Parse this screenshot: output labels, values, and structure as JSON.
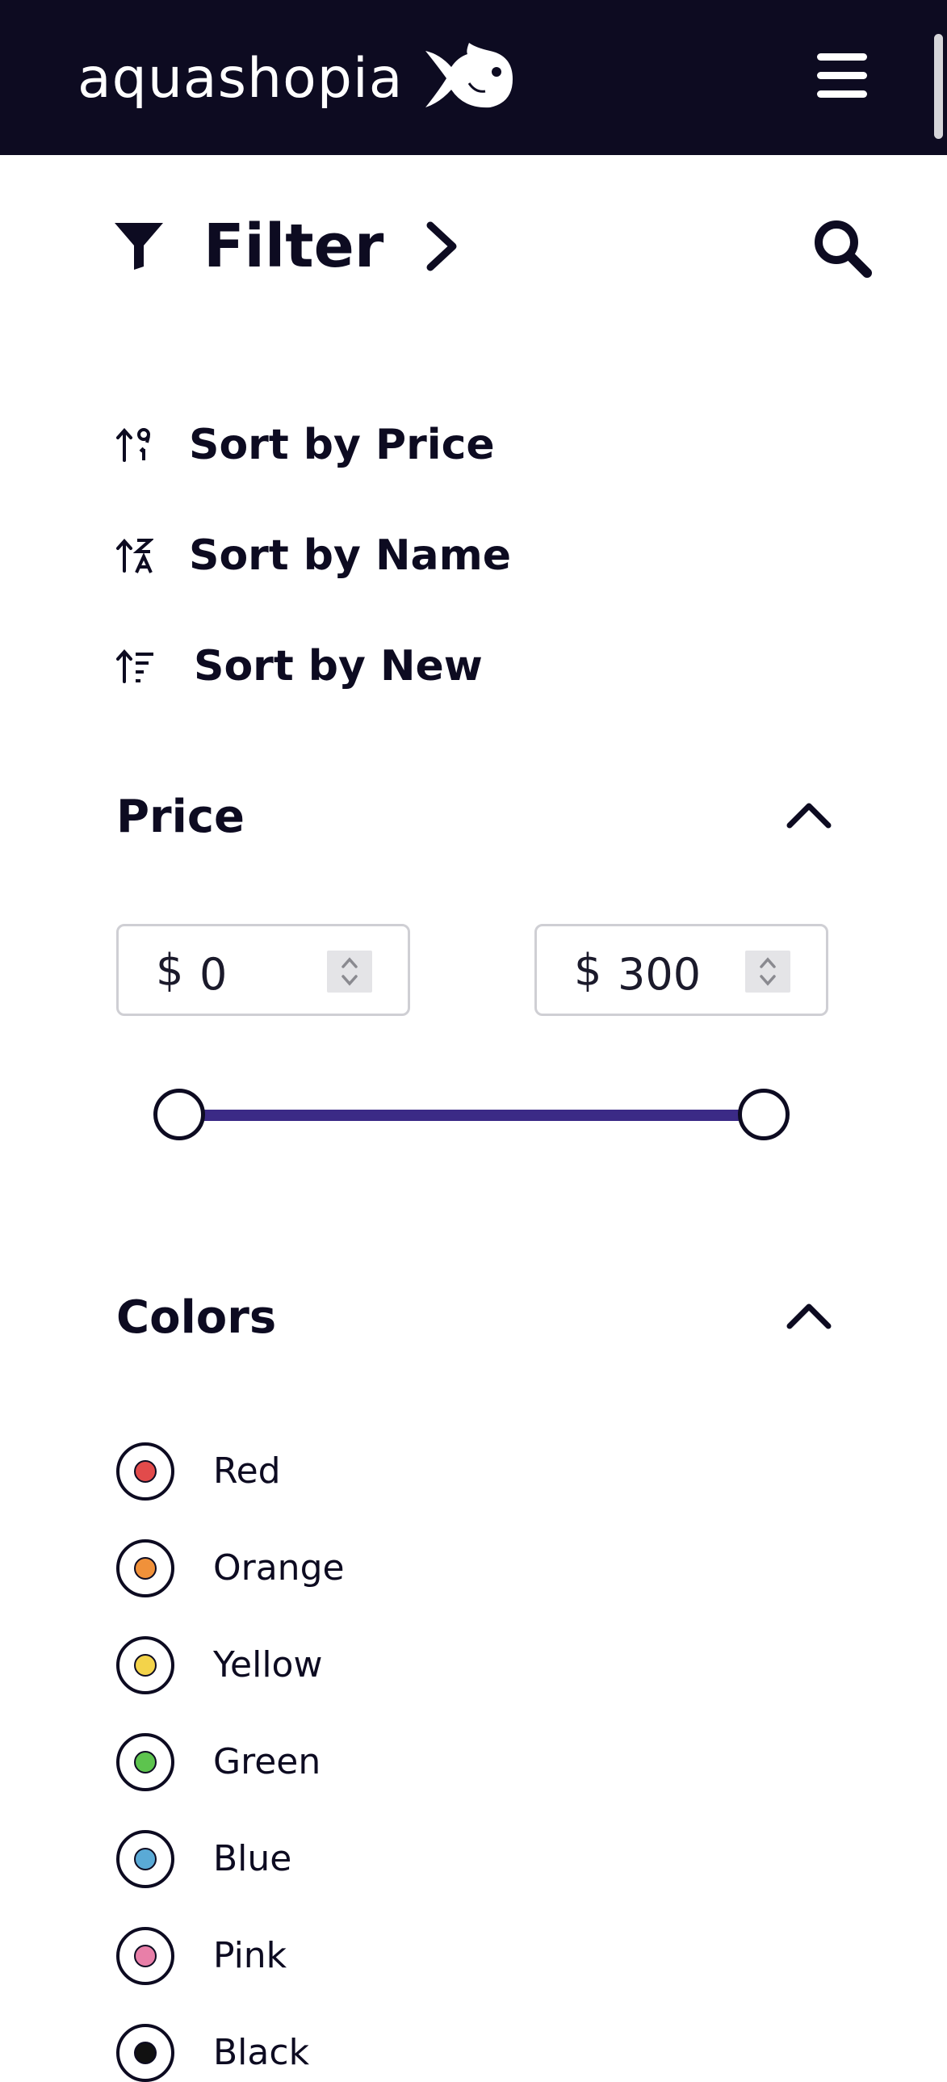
{
  "header": {
    "brand": "aquashopia",
    "logo_icon": "fish-icon",
    "menu_icon": "hamburger-menu-icon",
    "background": "#0d0b21"
  },
  "filter": {
    "label": "Filter",
    "icon": "funnel-icon",
    "expand_icon": "chevron-right-icon",
    "search_icon": "search-icon"
  },
  "sort": {
    "items": [
      {
        "label": "Sort by Price",
        "icon": "sort-numeric-icon"
      },
      {
        "label": "Sort by Name",
        "icon": "sort-alpha-icon"
      },
      {
        "label": "Sort by New",
        "icon": "sort-lines-icon"
      }
    ]
  },
  "price": {
    "title": "Price",
    "collapse_icon": "chevron-up-icon",
    "currency": "$",
    "min_value": "0",
    "max_value": "300",
    "range_fill_color": "#3b2a86",
    "range_selected_min_fraction": 0,
    "range_selected_max_fraction": 1
  },
  "colors": {
    "title": "Colors",
    "collapse_icon": "chevron-up-icon",
    "items": [
      {
        "label": "Red",
        "swatch": "#e24b4b"
      },
      {
        "label": "Orange",
        "swatch": "#f0913a"
      },
      {
        "label": "Yellow",
        "swatch": "#f3d34a"
      },
      {
        "label": "Green",
        "swatch": "#5dc44e"
      },
      {
        "label": "Blue",
        "swatch": "#5aaad6"
      },
      {
        "label": "Pink",
        "swatch": "#e87fa8"
      },
      {
        "label": "Black",
        "swatch": "#111111"
      }
    ]
  }
}
